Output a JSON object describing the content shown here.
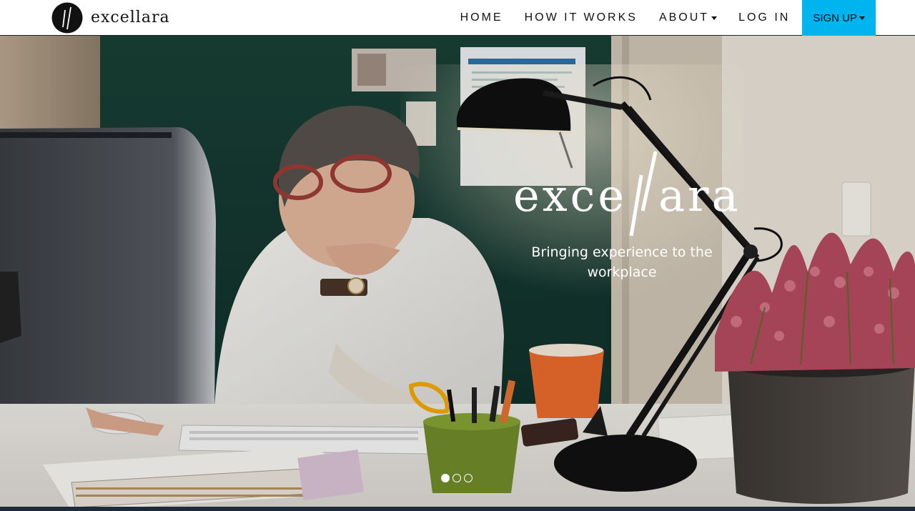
{
  "brand": {
    "name": "excellara",
    "logo_icon": "slash-circle-logo-icon"
  },
  "nav": {
    "items": [
      {
        "label": "HOME",
        "has_dropdown": false
      },
      {
        "label": "HOW IT WORKS",
        "has_dropdown": false
      },
      {
        "label": "ABOUT",
        "has_dropdown": true
      },
      {
        "label": "LOG IN",
        "has_dropdown": false
      }
    ],
    "signup": {
      "label": "SIGN UP",
      "has_dropdown": true
    }
  },
  "hero": {
    "wordmark": "excellara",
    "tagline": "Bringing experience to the workplace",
    "slide_count": 3,
    "active_slide": 1
  },
  "colors": {
    "accent": "#00b4f0",
    "nav_text": "#111111",
    "hero_text": "#ffffff"
  }
}
